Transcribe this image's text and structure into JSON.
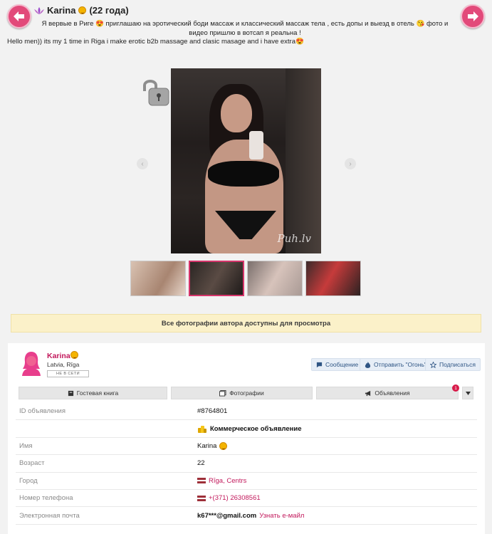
{
  "header": {
    "name": "Karina",
    "age": "(22 года)",
    "description_ru": "Я вервые в Риге 😍 приглашаю на эротический боди массаж и классический массаж тела , есть допы и выезд в отель 😘 фото и видео пришлю в вотсап я реальна !",
    "description_en": "Hello men)) its my 1 time in Riga i make erotic b2b massage and clasic masage and i have extra😍"
  },
  "gallery": {
    "watermark": "Puh.lv",
    "thumbnail_count": 4,
    "active_index": 1
  },
  "notice": "Все фотографии автора доступны для просмотра",
  "profile": {
    "name": "Karina",
    "location": "Latvia, Rīga",
    "status": "НЕ В СЕТИ"
  },
  "actions": {
    "message": "Сообщение",
    "fire": "Отправить \"Огонь\"",
    "subscribe": "Подписаться"
  },
  "tabs": {
    "guestbook": "Гостевая книга",
    "photos": "Фотографии",
    "ads": "Объявления",
    "ads_badge": "1"
  },
  "info": {
    "id_label": "ID объявления",
    "id_value": "#8764801",
    "commercial": "Коммерческое объявление",
    "name_label": "Имя",
    "name_value": "Karina",
    "age_label": "Возраст",
    "age_value": "22",
    "city_label": "Город",
    "city_value": "Rīga, Centrs",
    "phone_label": "Номер телефона",
    "phone_value": "+(371) 26308561",
    "email_label": "Электронная почта",
    "email_value": "k67***@gmail.com",
    "email_link": "Узнать е-майл"
  },
  "colors": {
    "accent": "#c2185b",
    "nav_arrow": "#e24a7a",
    "notice_bg": "#fbf1c9",
    "button_bg": "#e7eef7"
  }
}
